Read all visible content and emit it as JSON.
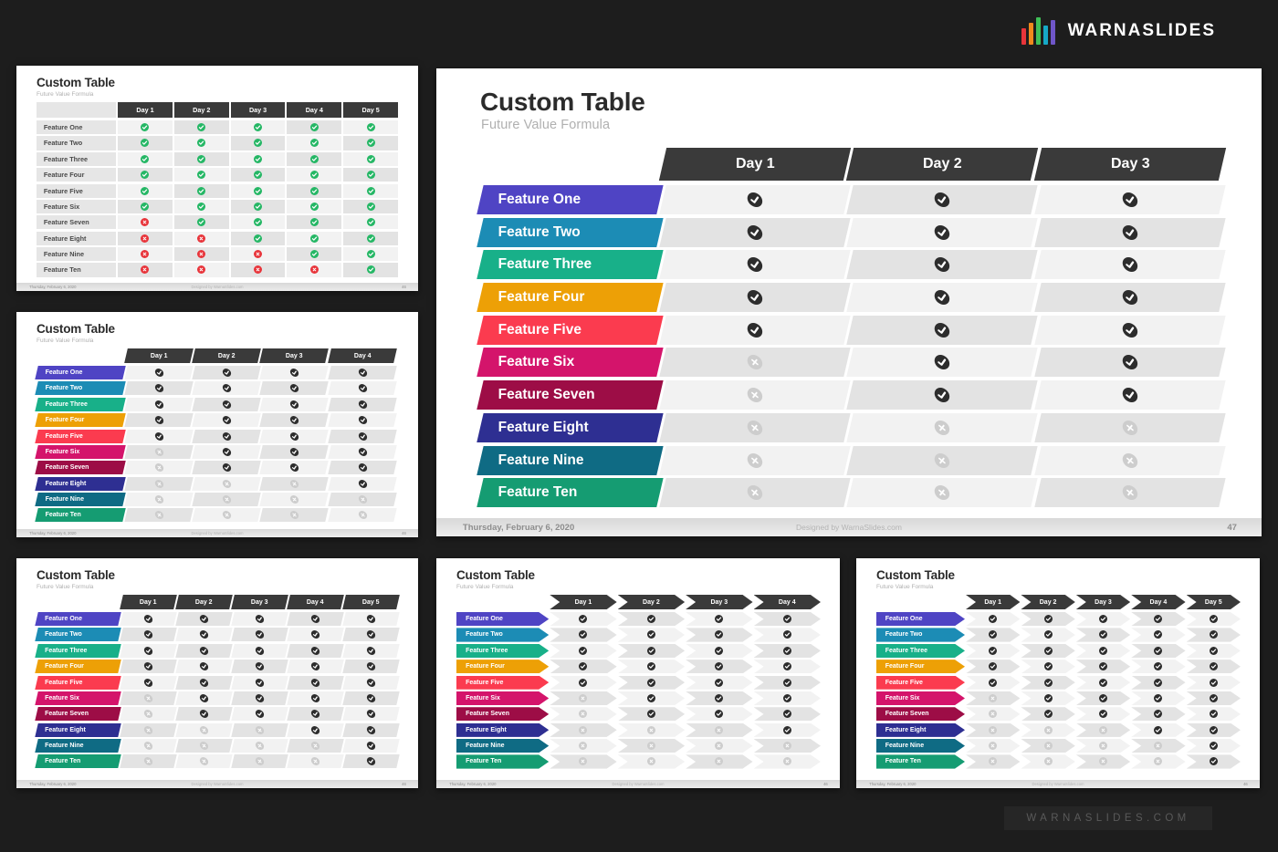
{
  "brand": {
    "name": "WARNASLIDES",
    "bar_colors": [
      "#e8343a",
      "#f08a1c",
      "#3fbf57",
      "#16a9c7",
      "#6f56c8"
    ],
    "watermark": "WARNASLIDES.COM"
  },
  "palette": {
    "header_dark": "#3a3a3a",
    "cell_light": "#f2f2f2",
    "cell_dark": "#e3e3e3",
    "icon_on": "#2d2d2d",
    "icon_off": "#cdcdcd",
    "icon_green": "#25b765",
    "icon_red": "#e8343a",
    "label_grey": "#e6e6e6"
  },
  "feature_colors": [
    "#4f44c4",
    "#1c8cb5",
    "#18b089",
    "#eda006",
    "#fb3b4f",
    "#d4146b",
    "#9d0d46",
    "#2e2f92",
    "#0f6b84",
    "#159c72"
  ],
  "features": [
    "Feature One",
    "Feature Two",
    "Feature Three",
    "Feature Four",
    "Feature Five",
    "Feature Six",
    "Feature Seven",
    "Feature Eight",
    "Feature Nine",
    "Feature Ten"
  ],
  "footer": {
    "date": "Thursday, February 6, 2020",
    "credit": "Designed by WarnaSlides.com",
    "page": "47",
    "thumb_page": "46"
  },
  "main_slide": {
    "title": "Custom Table",
    "subtitle": "Future Value Formula",
    "style": "skew",
    "days": [
      "Day 1",
      "Day 2",
      "Day 3"
    ],
    "matrix": [
      [
        "on",
        "on",
        "on"
      ],
      [
        "on",
        "on",
        "on"
      ],
      [
        "on",
        "on",
        "on"
      ],
      [
        "on",
        "on",
        "on"
      ],
      [
        "on",
        "on",
        "on"
      ],
      [
        "off",
        "on",
        "on"
      ],
      [
        "off",
        "on",
        "on"
      ],
      [
        "off",
        "off",
        "off"
      ],
      [
        "off",
        "off",
        "off"
      ],
      [
        "off",
        "off",
        "off"
      ]
    ]
  },
  "thumbnails": [
    {
      "id": "t1",
      "title": "Custom Table",
      "subtitle": "Future Value Formula",
      "style": "plain",
      "label_style": "grey",
      "icon_style": "green-red",
      "days": [
        "Day 1",
        "Day 2",
        "Day 3",
        "Day 4",
        "Day 5"
      ],
      "matrix": [
        [
          "on",
          "on",
          "on",
          "on",
          "on"
        ],
        [
          "on",
          "on",
          "on",
          "on",
          "on"
        ],
        [
          "on",
          "on",
          "on",
          "on",
          "on"
        ],
        [
          "on",
          "on",
          "on",
          "on",
          "on"
        ],
        [
          "on",
          "on",
          "on",
          "on",
          "on"
        ],
        [
          "on",
          "on",
          "on",
          "on",
          "on"
        ],
        [
          "off",
          "on",
          "on",
          "on",
          "on"
        ],
        [
          "off",
          "off",
          "on",
          "on",
          "on"
        ],
        [
          "off",
          "off",
          "off",
          "on",
          "on"
        ],
        [
          "off",
          "off",
          "off",
          "off",
          "on"
        ]
      ]
    },
    {
      "id": "t2",
      "title": "Custom Table",
      "subtitle": "Future Value Formula",
      "style": "skew",
      "label_style": "color",
      "icon_style": "dark-grey",
      "days": [
        "Day 1",
        "Day 2",
        "Day 3",
        "Day 4"
      ],
      "matrix": [
        [
          "on",
          "on",
          "on",
          "on"
        ],
        [
          "on",
          "on",
          "on",
          "on"
        ],
        [
          "on",
          "on",
          "on",
          "on"
        ],
        [
          "on",
          "on",
          "on",
          "on"
        ],
        [
          "on",
          "on",
          "on",
          "on"
        ],
        [
          "off",
          "on",
          "on",
          "on"
        ],
        [
          "off",
          "on",
          "on",
          "on"
        ],
        [
          "off",
          "off",
          "off",
          "on"
        ],
        [
          "off",
          "off",
          "off",
          "off"
        ],
        [
          "off",
          "off",
          "off",
          "off"
        ]
      ]
    },
    {
      "id": "t3",
      "title": "Custom Table",
      "subtitle": "Future Value Formula",
      "style": "skew",
      "label_style": "color",
      "icon_style": "dark-grey",
      "days": [
        "Day 1",
        "Day 2",
        "Day 3",
        "Day 4",
        "Day 5"
      ],
      "matrix": [
        [
          "on",
          "on",
          "on",
          "on",
          "on"
        ],
        [
          "on",
          "on",
          "on",
          "on",
          "on"
        ],
        [
          "on",
          "on",
          "on",
          "on",
          "on"
        ],
        [
          "on",
          "on",
          "on",
          "on",
          "on"
        ],
        [
          "on",
          "on",
          "on",
          "on",
          "on"
        ],
        [
          "off",
          "on",
          "on",
          "on",
          "on"
        ],
        [
          "off",
          "on",
          "on",
          "on",
          "on"
        ],
        [
          "off",
          "off",
          "off",
          "on",
          "on"
        ],
        [
          "off",
          "off",
          "off",
          "off",
          "on"
        ],
        [
          "off",
          "off",
          "off",
          "off",
          "on"
        ]
      ]
    },
    {
      "id": "t4",
      "title": "Custom Table",
      "subtitle": "Future Value Formula",
      "style": "chevron",
      "label_style": "color",
      "icon_style": "dark-grey",
      "days": [
        "Day 1",
        "Day 2",
        "Day 3",
        "Day 4"
      ],
      "matrix": [
        [
          "on",
          "on",
          "on",
          "on"
        ],
        [
          "on",
          "on",
          "on",
          "on"
        ],
        [
          "on",
          "on",
          "on",
          "on"
        ],
        [
          "on",
          "on",
          "on",
          "on"
        ],
        [
          "on",
          "on",
          "on",
          "on"
        ],
        [
          "off",
          "on",
          "on",
          "on"
        ],
        [
          "off",
          "on",
          "on",
          "on"
        ],
        [
          "off",
          "off",
          "off",
          "on"
        ],
        [
          "off",
          "off",
          "off",
          "off"
        ],
        [
          "off",
          "off",
          "off",
          "off"
        ]
      ]
    },
    {
      "id": "t5",
      "title": "Custom Table",
      "subtitle": "Future Value Formula",
      "style": "chevron",
      "label_style": "color",
      "icon_style": "dark-grey",
      "days": [
        "Day 1",
        "Day 2",
        "Day 3",
        "Day 4",
        "Day 5"
      ],
      "matrix": [
        [
          "on",
          "on",
          "on",
          "on",
          "on"
        ],
        [
          "on",
          "on",
          "on",
          "on",
          "on"
        ],
        [
          "on",
          "on",
          "on",
          "on",
          "on"
        ],
        [
          "on",
          "on",
          "on",
          "on",
          "on"
        ],
        [
          "on",
          "on",
          "on",
          "on",
          "on"
        ],
        [
          "off",
          "on",
          "on",
          "on",
          "on"
        ],
        [
          "off",
          "on",
          "on",
          "on",
          "on"
        ],
        [
          "off",
          "off",
          "off",
          "on",
          "on"
        ],
        [
          "off",
          "off",
          "off",
          "off",
          "on"
        ],
        [
          "off",
          "off",
          "off",
          "off",
          "on"
        ]
      ]
    }
  ]
}
